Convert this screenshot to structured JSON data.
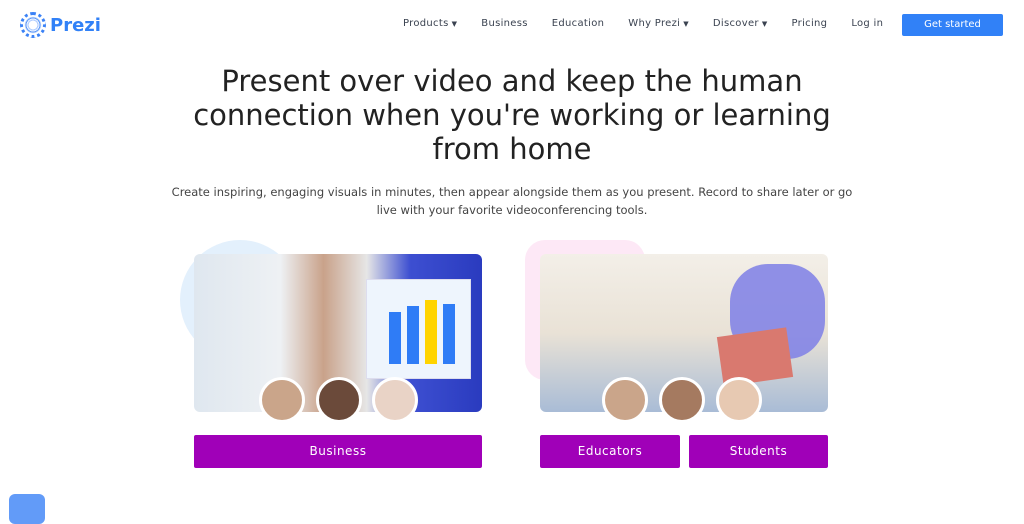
{
  "brand": {
    "name": "Prezi"
  },
  "nav": {
    "items": [
      {
        "label": "Products",
        "dropdown": true
      },
      {
        "label": "Business"
      },
      {
        "label": "Education"
      },
      {
        "label": "Why Prezi",
        "dropdown": true
      },
      {
        "label": "Discover",
        "dropdown": true
      },
      {
        "label": "Pricing"
      },
      {
        "label": "Log in"
      }
    ],
    "cta": "Get started"
  },
  "hero": {
    "title": "Present over video and keep the human connection when you're working or learning from home",
    "subtitle": "Create inspiring, engaging visuals in minutes, then appear alongside them as you present. Record to share later or go live with your favorite videoconferencing tools."
  },
  "cards": {
    "business_button": "Business",
    "educators_button": "Educators",
    "students_button": "Students"
  },
  "colors": {
    "accent": "#3181f7",
    "purple": "#a000b8"
  }
}
